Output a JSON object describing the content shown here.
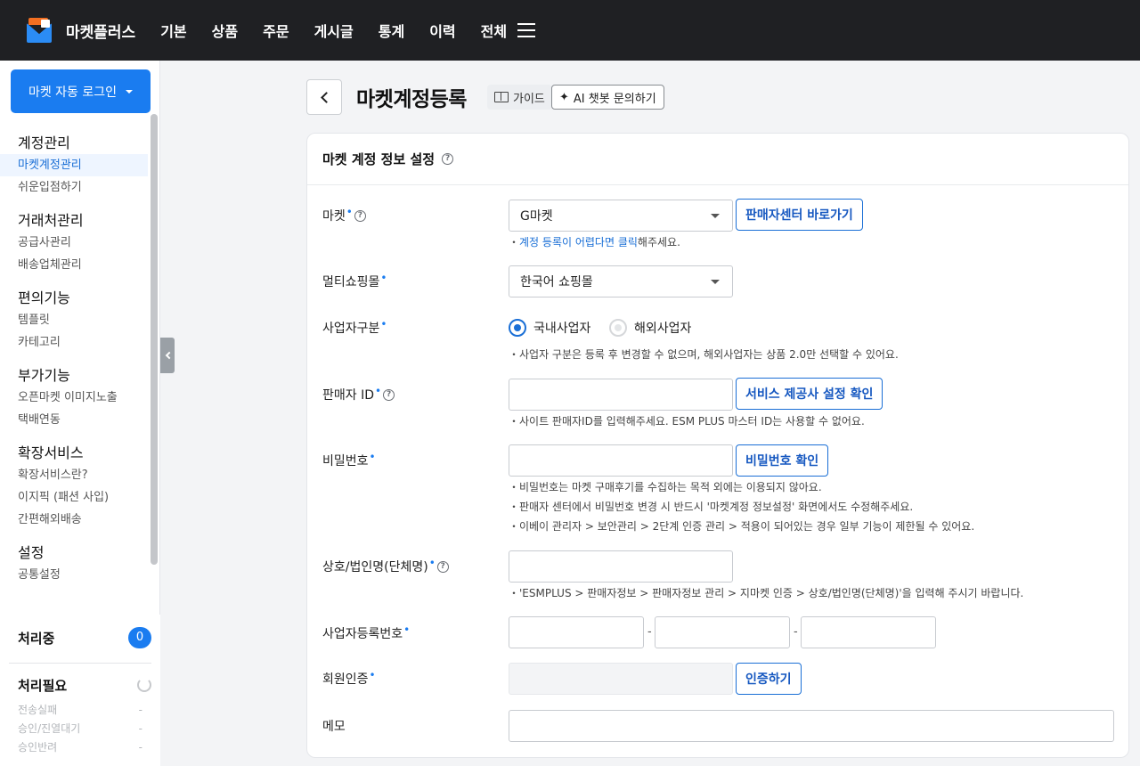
{
  "app": {
    "name": "마켓플러스"
  },
  "nav": {
    "items": [
      "기본",
      "상품",
      "주문",
      "게시글",
      "통계",
      "이력",
      "전체"
    ]
  },
  "sidebar": {
    "login_button": "마켓 자동 로그인",
    "sections": [
      {
        "title": "계정관리",
        "items": [
          "마켓계정관리",
          "쉬운입점하기"
        ]
      },
      {
        "title": "거래처관리",
        "items": [
          "공급사관리",
          "배송업체관리"
        ]
      },
      {
        "title": "편의기능",
        "items": [
          "템플릿",
          "카테고리"
        ]
      },
      {
        "title": "부가기능",
        "items": [
          "오픈마켓 이미지노출",
          "택배연동"
        ]
      },
      {
        "title": "확장서비스",
        "items": [
          "확장서비스란?",
          "이지픽 (패션 사입)",
          "간편해외배송"
        ]
      },
      {
        "title": "설정",
        "items": [
          "공통설정"
        ]
      }
    ],
    "active_item": "마켓계정관리",
    "processing": {
      "label": "처리중",
      "count": "0"
    },
    "needs_action": {
      "label": "처리필요",
      "rows": [
        {
          "label": "전송실패",
          "value": "-"
        },
        {
          "label": "승인/진열대기",
          "value": "-"
        },
        {
          "label": "승인반려",
          "value": "-"
        }
      ]
    }
  },
  "page": {
    "title": "마켓계정등록",
    "guide_button": "가이드",
    "ai_button": "AI 챗봇 문의하기"
  },
  "form": {
    "card_title": "마켓 계정 정보 설정",
    "market": {
      "label": "마켓",
      "value": "G마켓",
      "button": "판매자센터 바로가기",
      "hint_prefix": "・",
      "hint_link": "계정 등록이 어렵다면 클릭",
      "hint_suffix": "해주세요."
    },
    "multishop": {
      "label": "멀티쇼핑몰",
      "value": "한국어 쇼핑몰"
    },
    "biz_type": {
      "label": "사업자구분",
      "options": [
        "국내사업자",
        "해외사업자"
      ],
      "selected": "국내사업자",
      "hint": "・사업자 구분은 등록 후 변경할 수 없으며, 해외사업자는 상품 2.0만 선택할 수 있어요."
    },
    "seller_id": {
      "label": "판매자 ID",
      "value": "",
      "button": "서비스 제공사 설정 확인",
      "hint": "・사이트 판매자ID를 입력해주세요. ESM PLUS 마스터 ID는 사용할 수 없어요."
    },
    "password": {
      "label": "비밀번호",
      "value": "",
      "button": "비밀번호 확인",
      "hints": [
        "・비밀번호는 마켓 구매후기를 수집하는 목적 외에는 이용되지 않아요.",
        "・판매자 센터에서 비밀번호 변경 시 반드시 '마켓계정 정보설정' 화면에서도 수정해주세요.",
        "・이베이 관리자 > 보안관리 > 2단계 인증 관리 > 적용이 되어있는 경우 일부 기능이 제한될 수 있어요."
      ]
    },
    "company_name": {
      "label": "상호/법인명(단체명)",
      "value": "",
      "hint": "・'ESMPLUS > 판매자정보 > 판매자정보 관리 > 지마켓 인증 > 상호/법인명(단체명)'을 입력해 주시기 바랍니다."
    },
    "biz_number": {
      "label": "사업자등록번호",
      "separator": "-",
      "parts": [
        "",
        "",
        ""
      ]
    },
    "member_auth": {
      "label": "회원인증",
      "button": "인증하기"
    },
    "memo": {
      "label": "메모",
      "value": ""
    },
    "required_mark": "•",
    "help_glyph": "?"
  },
  "colors": {
    "accent": "#1a7cf0",
    "topbar": "#1f2023"
  },
  "icons": [
    "logo-icon",
    "menu-icon",
    "chevron-down-icon",
    "back-arrow-icon",
    "book-icon",
    "sparkle-icon",
    "help-icon",
    "refresh-icon",
    "collapse-left-icon"
  ]
}
